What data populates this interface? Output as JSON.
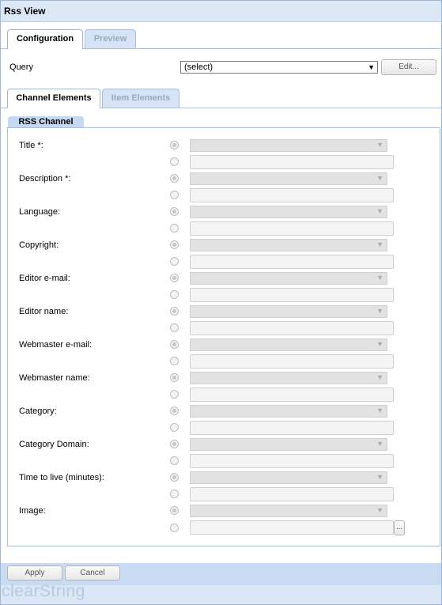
{
  "window": {
    "title": "Rss View"
  },
  "top_tabs": [
    {
      "label": "Configuration",
      "active": true
    },
    {
      "label": "Preview",
      "active": false
    }
  ],
  "query": {
    "label": "Query",
    "selected": "(select)",
    "edit_label": "Edit..."
  },
  "sub_tabs": [
    {
      "label": "Channel Elements",
      "active": true
    },
    {
      "label": "Item Elements",
      "active": false
    }
  ],
  "group": {
    "title": "RSS Channel",
    "fields": [
      {
        "label": "Title *:"
      },
      {
        "label": "Description *:"
      },
      {
        "label": "Language:"
      },
      {
        "label": "Copyright:"
      },
      {
        "label": "Editor e-mail:"
      },
      {
        "label": "Editor name:"
      },
      {
        "label": "Webmaster e-mail:"
      },
      {
        "label": "Webmaster name:"
      },
      {
        "label": "Category:"
      },
      {
        "label": "Category Domain:"
      },
      {
        "label": "Time to live (minutes):"
      },
      {
        "label": "Image:"
      }
    ],
    "browse_label": "..."
  },
  "buttons": {
    "apply": "Apply",
    "cancel": "Cancel"
  },
  "brand": "clearString",
  "colors": {
    "header_bg": "#dde8f7",
    "footer_bg": "#c9dbf3",
    "tab_inactive_text": "#9aaac0"
  }
}
